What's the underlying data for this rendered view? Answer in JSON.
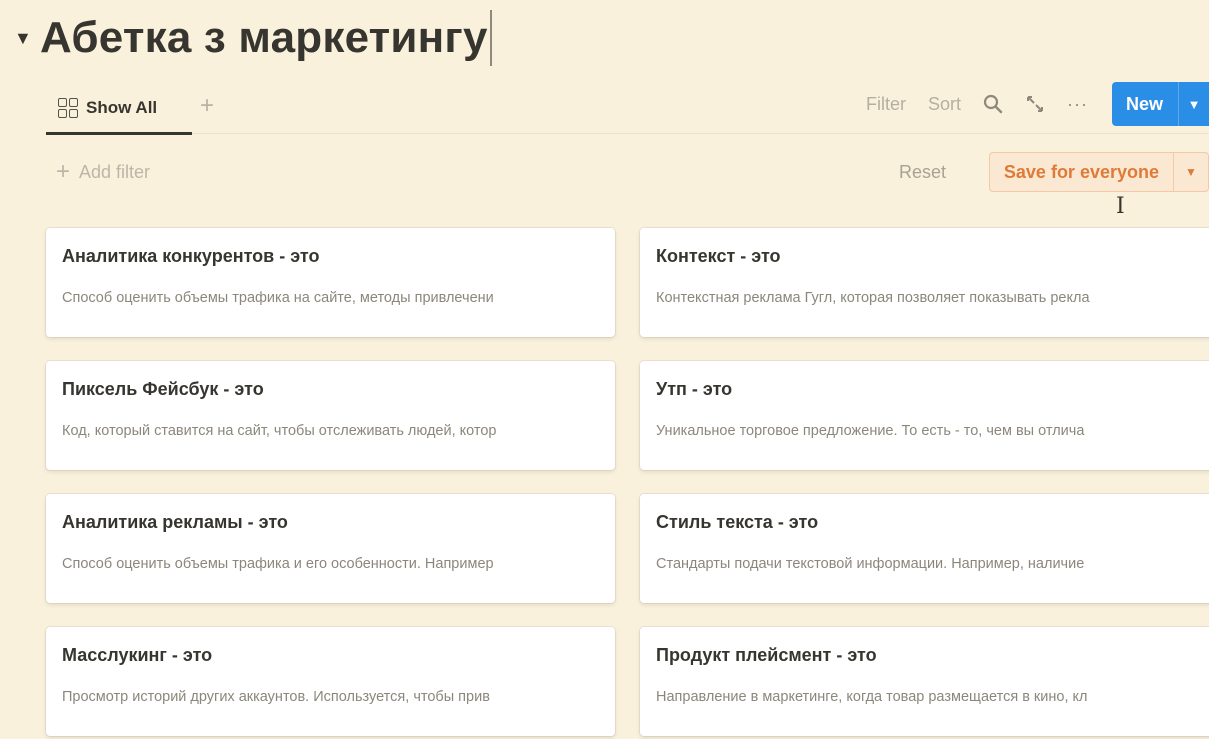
{
  "page": {
    "title": "Абетка з маркетингу"
  },
  "view": {
    "tab_label": "Show All",
    "toolbar": {
      "filter_label": "Filter",
      "sort_label": "Sort",
      "dots_label": "···",
      "new_label": "New"
    }
  },
  "filters": {
    "add_filter_label": "Add filter",
    "reset_label": "Reset",
    "save_label": "Save for everyone"
  },
  "cards": [
    {
      "title": "Аналитика конкурентов - это",
      "description": "Способ оценить объемы трафика на сайте, методы привлечени"
    },
    {
      "title": "Контекст - это",
      "description": "Контекстная реклама Гугл, которая позволяет показывать рекла"
    },
    {
      "title": "Пиксель Фейсбук - это",
      "description": "Код, который ставится на сайт, чтобы отслеживать людей, котор"
    },
    {
      "title": "Утп - это",
      "description": "Уникальное торговое предложение. То есть - то, чем вы отлича"
    },
    {
      "title": "Аналитика рекламы - это",
      "description": "Способ оценить объемы трафика и его особенности. Например"
    },
    {
      "title": "Стиль текста - это",
      "description": "Стандарты подачи текстовой информации. Например, наличие"
    },
    {
      "title": "Масслукинг - это",
      "description": "Просмотр историй других аккаунтов. Используется, чтобы прив"
    },
    {
      "title": "Продукт плейсмент - это",
      "description": "Направление в маркетинге, когда товар размещается в кино, кл"
    }
  ],
  "colors": {
    "background": "#faf1dc",
    "primary": "#2b8ee6",
    "save_accent": "#de7b38"
  }
}
